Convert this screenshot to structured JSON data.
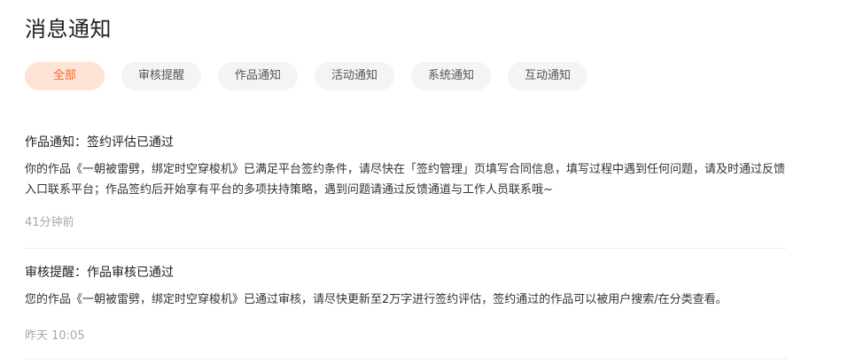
{
  "header": {
    "title": "消息通知"
  },
  "tabs": [
    {
      "label": "全部",
      "active": true
    },
    {
      "label": "审核提醒",
      "active": false
    },
    {
      "label": "作品通知",
      "active": false
    },
    {
      "label": "活动通知",
      "active": false
    },
    {
      "label": "系统通知",
      "active": false
    },
    {
      "label": "互动通知",
      "active": false
    }
  ],
  "notices": [
    {
      "title": "作品通知：签约评估已通过",
      "body": "你的作品《一朝被雷劈，绑定时空穿梭机》已满足平台签约条件，请尽快在「签约管理」页填写合同信息，填写过程中遇到任何问题，请及时通过反馈入口联系平台；作品签约后开始享有平台的多项扶持策略，遇到问题请通过反馈通道与工作人员联系哦~",
      "time": "41分钟前"
    },
    {
      "title": "审核提醒：作品审核已通过",
      "body": "您的作品《一朝被雷劈，绑定时空穿梭机》已通过审核，请尽快更新至2万字进行签约评估，签约通过的作品可以被用户搜索/在分类查看。",
      "time": "昨天 10:05"
    }
  ],
  "colors": {
    "accent": "#f2682a",
    "accent_bg": "#ffe3d6",
    "tab_bg": "#f4f4f4",
    "muted_text": "#a8a8a8"
  }
}
